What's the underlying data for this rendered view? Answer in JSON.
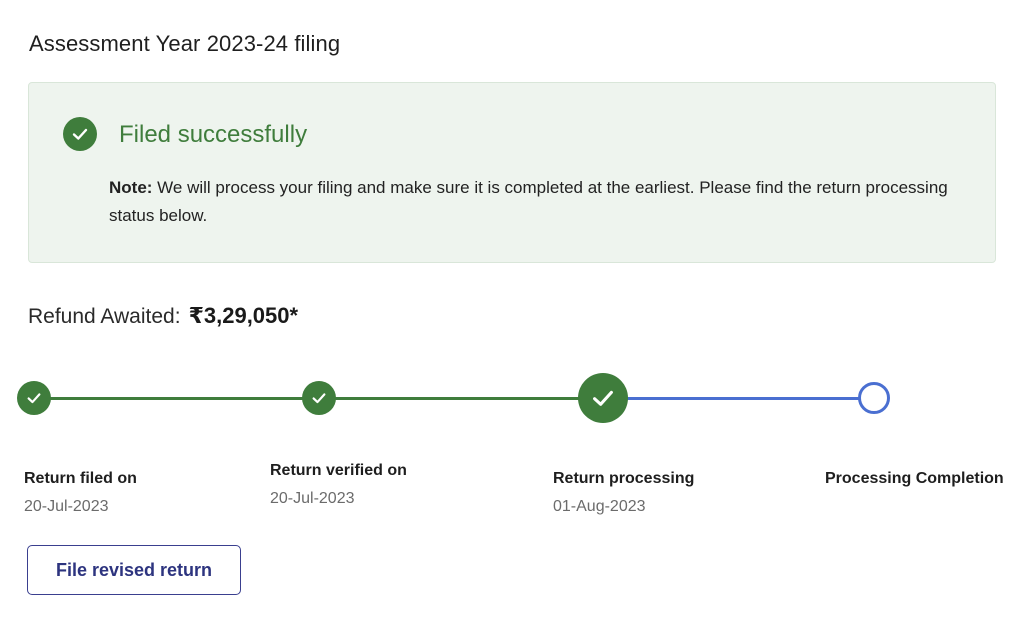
{
  "heading": "Assessment Year 2023-24 filing",
  "status_box": {
    "title": "Filed successfully",
    "note_label": "Note:",
    "note_text": " We will process your filing and make sure it is completed at the earliest. Please find the return processing status below.",
    "icon": "check-circle-icon"
  },
  "refund": {
    "label": "Refund Awaited:",
    "amount": "₹3,29,050*"
  },
  "tracker": {
    "steps": [
      {
        "label": "Return filed on",
        "date": "20-Jul-2023",
        "state": "done"
      },
      {
        "label": "Return verified on",
        "date": "20-Jul-2023",
        "state": "done"
      },
      {
        "label": "Return processing",
        "date": "01-Aug-2023",
        "state": "current"
      },
      {
        "label": "Processing Completion",
        "date": "",
        "state": "pending"
      }
    ]
  },
  "actions": {
    "revise_label": "File revised return"
  },
  "colors": {
    "success_green": "#3f7d3c",
    "progress_blue": "#4a6fd1",
    "box_bg": "#eef4ee",
    "button_text": "#2d347f"
  }
}
